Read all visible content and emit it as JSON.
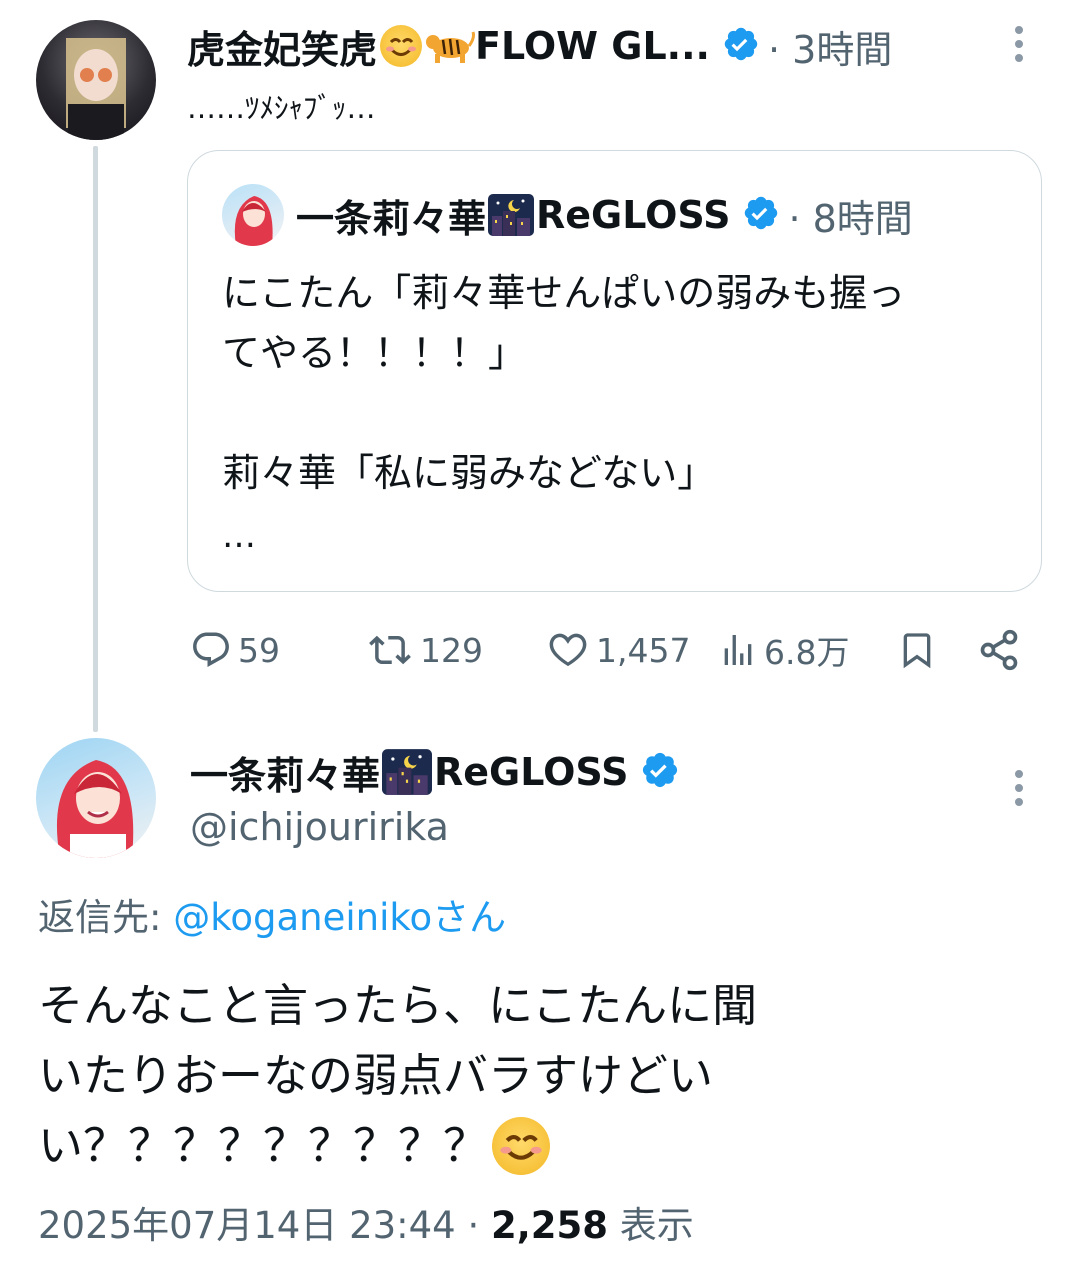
{
  "tweet1": {
    "author_name": "虎金妃笑虎",
    "author_name_suffix": "FLOW GL...",
    "time": "· 3時間",
    "text": "……ﾂﾒｼｬﾌﾞｯ…"
  },
  "quote": {
    "author_name": "一条莉々華",
    "author_name_suffix": "ReGLOSS",
    "time": "· 8時間",
    "line1": "にこたん「莉々華せんぱいの弱みも握っ",
    "line2": "てやる！！！！」",
    "line3": "莉々華「私に弱みなどない」",
    "line4": "…"
  },
  "actions": {
    "replies": "59",
    "retweets": "129",
    "likes": "1,457",
    "views": "6.8万"
  },
  "tweet2": {
    "author_name": "一条莉々華",
    "author_name_suffix": "ReGLOSS",
    "handle": "@ichijouririka",
    "reply_prefix": "返信先: ",
    "reply_to": "@koganeinikoさん",
    "line1": "そんなこと言ったら、にこたんに聞",
    "line2": "いたりおーなの弱点バラすけどい",
    "line3": "い？？？？？？？？？",
    "date": "2025年07月14日 23:44 · ",
    "view_count": "2,258",
    "view_label": " 表示"
  },
  "icons": [
    "verified-badge",
    "smiling-face-emoji",
    "tiger-emoji",
    "night-city-emoji",
    "reply-icon",
    "retweet-icon",
    "like-icon",
    "views-icon",
    "bookmark-icon",
    "share-icon",
    "more-icon"
  ],
  "colors": {
    "verified": "#1d9bf0",
    "link": "#1d9bf0",
    "muted": "#536471",
    "border": "#cfd9de"
  }
}
